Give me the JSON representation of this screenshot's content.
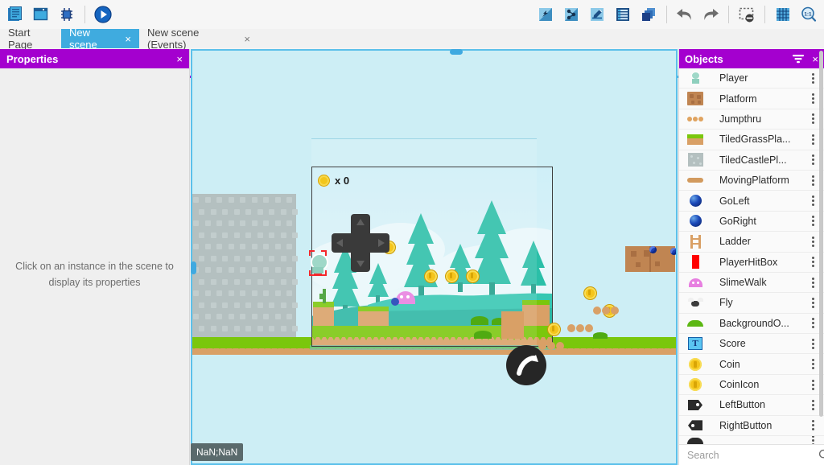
{
  "toolbar": {
    "left_buttons": [
      {
        "name": "open-project-icon",
        "label": "Open Project"
      },
      {
        "name": "new-scene-icon",
        "label": "New Scene"
      },
      {
        "name": "debug-icon",
        "label": "Debugger"
      },
      {
        "name": "preview-play-icon",
        "label": "Preview"
      }
    ],
    "right_buttons": [
      {
        "name": "add-object-icon",
        "label": "Add an object"
      },
      {
        "name": "objects-groups-icon",
        "label": "Object groups"
      },
      {
        "name": "edit-properties-icon",
        "label": "Scene properties"
      },
      {
        "name": "open-events-icon",
        "label": "Open events"
      },
      {
        "name": "layers-icon",
        "label": "Layers"
      },
      {
        "name": "undo-icon",
        "label": "Undo"
      },
      {
        "name": "redo-icon",
        "label": "Redo"
      },
      {
        "name": "toggle-mask-icon",
        "label": "Toggle masks"
      },
      {
        "name": "grid-icon",
        "label": "Toggle grid"
      },
      {
        "name": "zoom-reset-icon",
        "label": "Zoom 1:1"
      }
    ]
  },
  "tabs": [
    {
      "label": "Start Page",
      "active": false,
      "closable": false
    },
    {
      "label": "New scene",
      "active": true,
      "closable": true,
      "close_label": "×"
    },
    {
      "label": "New scene (Events)",
      "active": false,
      "closable": true,
      "close_label": "×"
    }
  ],
  "properties": {
    "title": "Properties",
    "close_label": "×",
    "empty_message": "Click on an instance in the scene to display its properties"
  },
  "scene": {
    "hud_coin_text": "x 0",
    "coordinates_tooltip": "NaN;NaN"
  },
  "objects": {
    "title": "Objects",
    "close_label": "×",
    "filter_label": "Filter",
    "search_placeholder": "Search",
    "items": [
      {
        "label": "Player",
        "thumb": "player-thumb"
      },
      {
        "label": "Platform",
        "thumb": "platform-thumb"
      },
      {
        "label": "Jumpthru",
        "thumb": "jumpthru-thumb"
      },
      {
        "label": "TiledGrassPla...",
        "thumb": "tiled-grass-thumb"
      },
      {
        "label": "TiledCastlePl...",
        "thumb": "tiled-castle-thumb"
      },
      {
        "label": "MovingPlatform",
        "thumb": "moving-platform-thumb"
      },
      {
        "label": "GoLeft",
        "thumb": "goleft-thumb"
      },
      {
        "label": "GoRight",
        "thumb": "goright-thumb"
      },
      {
        "label": "Ladder",
        "thumb": "ladder-thumb"
      },
      {
        "label": "PlayerHitBox",
        "thumb": "playerhitbox-thumb"
      },
      {
        "label": "SlimeWalk",
        "thumb": "slimewalk-thumb"
      },
      {
        "label": "Fly",
        "thumb": "fly-thumb"
      },
      {
        "label": "BackgroundO...",
        "thumb": "background-thumb"
      },
      {
        "label": "Score",
        "thumb": "score-thumb"
      },
      {
        "label": "Coin",
        "thumb": "coin-thumb"
      },
      {
        "label": "CoinIcon",
        "thumb": "coinicon-thumb"
      },
      {
        "label": "LeftButton",
        "thumb": "leftbutton-thumb"
      },
      {
        "label": "RightButton",
        "thumb": "rightbutton-thumb"
      }
    ]
  },
  "colors": {
    "panel_header": "#a400cf",
    "active_tab": "#3fabdf",
    "scene_background": "#cdeef5",
    "grass": "#7ac70c",
    "dirt": "#d9a066",
    "coin": "#f5c51c"
  }
}
